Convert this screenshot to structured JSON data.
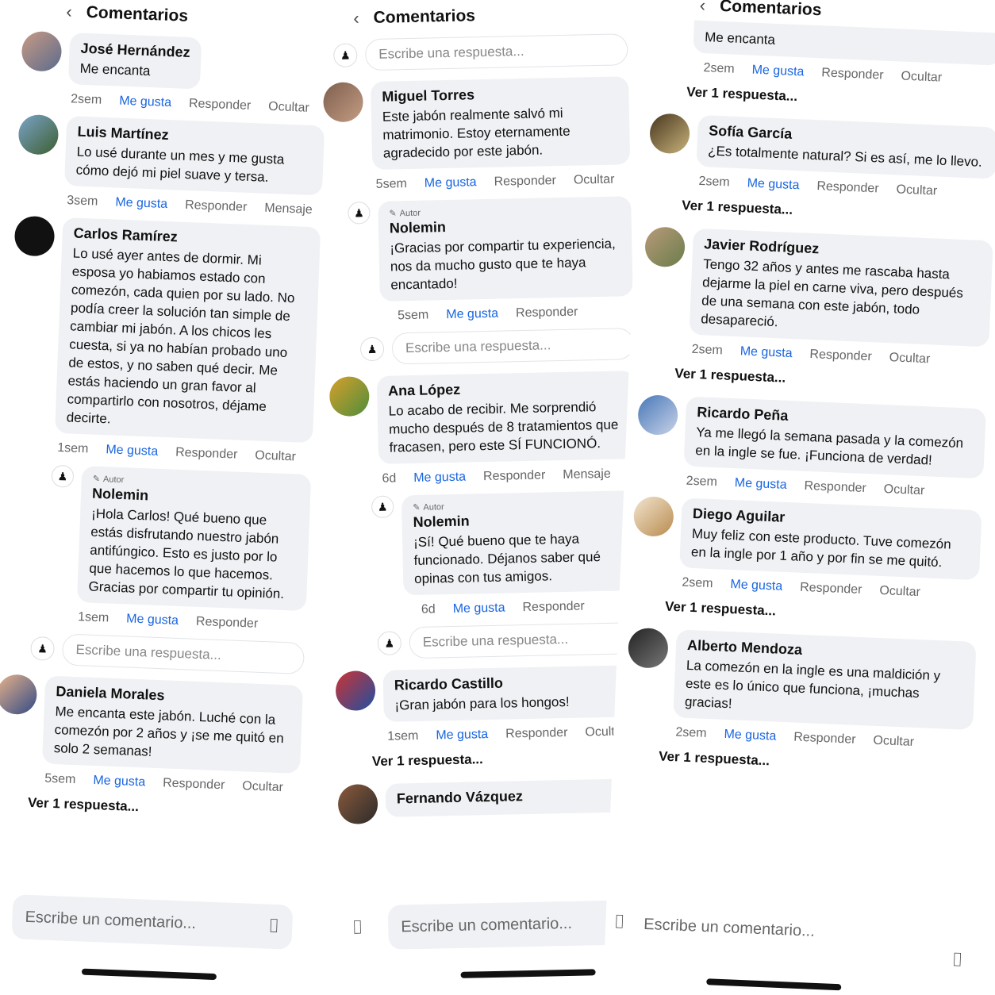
{
  "header": {
    "title": "Comentarios"
  },
  "actions": {
    "like": "Me gusta",
    "reply": "Responder",
    "hide": "Ocultar",
    "message": "Mensaje"
  },
  "reply_placeholder": "Escribe una respuesta...",
  "comment_placeholder": "Escribe un comentario...",
  "author_badge": "Autor",
  "view_replies": "Ver 1 respuesta...",
  "panel1": {
    "comments": [
      {
        "name": "José Hernández",
        "text": "Me encanta",
        "time": "2sem"
      },
      {
        "name": "Luis Martínez",
        "text": "Lo usé durante un mes y me gusta cómo dejó mi piel suave y tersa.",
        "time": "3sem"
      },
      {
        "name": "Carlos Ramírez",
        "text": "Lo usé ayer antes de dormir. Mi esposa yo habiamos estado con comezón, cada quien por su lado. No podía creer la solución tan simple de cambiar mi jabón. A los chicos les cuesta, si ya no habían probado uno de estos, y no saben qué decir. Me estás haciendo un gran favor al compartirlo con nosotros, déjame decirte.",
        "time": "1sem"
      },
      {
        "name": "Daniela Morales",
        "text": "Me encanta este jabón. Luché con la comezón por 2 años y ¡se me quitó en solo 2 semanas!",
        "time": "5sem"
      }
    ],
    "reply": {
      "name": "Nolemin",
      "text": "¡Hola Carlos! Qué bueno que estás disfrutando nuestro jabón antifúngico. Esto es justo por lo que hacemos lo que hacemos. Gracias por compartir tu opinión.",
      "time": "1sem"
    }
  },
  "panel2": {
    "comments": [
      {
        "name": "Miguel Torres",
        "text": "Este jabón realmente salvó mi matrimonio. Estoy eternamente agradecido por este jabón.",
        "time": "5sem"
      },
      {
        "name": "Ana López",
        "text": "Lo acabo de recibir. Me sorprendió mucho después de 8 tratamientos que fracasen, pero este SÍ FUNCIONÓ.",
        "time": "6d"
      },
      {
        "name": "Ricardo Castillo",
        "text": "¡Gran jabón para los hongos!",
        "time": "1sem"
      },
      {
        "name": "Fernando Vázquez",
        "text": "",
        "time": ""
      }
    ],
    "reply1": {
      "name": "Nolemin",
      "text": "¡Gracias por compartir tu experiencia, nos da mucho gusto que te haya encantado!",
      "time": "5sem"
    },
    "reply2": {
      "name": "Nolemin",
      "text": "¡Sí! Qué bueno que te haya funcionado. Déjanos saber qué opinas con tus amigos.",
      "time": "6d"
    }
  },
  "panel3": {
    "comments": [
      {
        "name": "",
        "text": "Me encanta",
        "time": "2sem"
      },
      {
        "name": "Sofía García",
        "text": "¿Es totalmente natural? Si es así, me lo llevo.",
        "time": "2sem"
      },
      {
        "name": "Javier Rodríguez",
        "text": "Tengo 32 años y antes me rascaba hasta dejarme la piel en carne viva, pero después de una semana con este jabón, todo desapareció.",
        "time": "2sem"
      },
      {
        "name": "Ricardo Peña",
        "text": "Ya me llegó la semana pasada y la comezón en la ingle se fue. ¡Funciona de verdad!",
        "time": "2sem"
      },
      {
        "name": "Diego Aguilar",
        "text": "Muy feliz con este producto. Tuve comezón en la ingle por 1 año y por fin se me quitó.",
        "time": "2sem"
      },
      {
        "name": "Alberto Mendoza",
        "text": "La comezón en la ingle es una maldición y este es lo único que funciona, ¡muchas gracias!",
        "time": "2sem"
      }
    ]
  }
}
